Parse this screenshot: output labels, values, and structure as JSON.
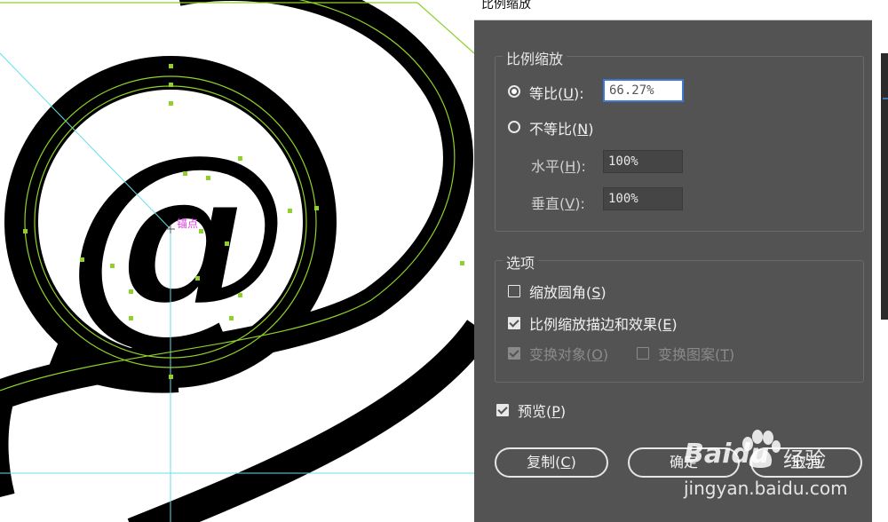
{
  "canvas": {
    "anchor_label": "锚点"
  },
  "dialog": {
    "title": "比例缩放",
    "scale_group": {
      "title": "比例缩放",
      "uniform": {
        "label": "等比",
        "key": "U",
        "value": "66.27%",
        "selected": true
      },
      "non_uniform": {
        "label": "不等比",
        "key": "N",
        "selected": false
      },
      "horizontal": {
        "label": "水平",
        "key": "H",
        "value": "100%"
      },
      "vertical": {
        "label": "垂直",
        "key": "V",
        "value": "100%"
      }
    },
    "options_group": {
      "title": "选项",
      "scale_corners": {
        "label": "缩放圆角",
        "key": "S",
        "checked": false
      },
      "scale_strokes": {
        "label": "比例缩放描边和效果",
        "key": "E",
        "checked": true
      },
      "transform_objects": {
        "label": "变换对象",
        "key": "O",
        "checked": true,
        "disabled": true
      },
      "transform_patterns": {
        "label": "变换图案",
        "key": "T",
        "checked": false,
        "disabled": true
      }
    },
    "preview": {
      "label": "预览",
      "key": "P",
      "checked": true
    },
    "buttons": {
      "copy": {
        "label": "复制",
        "key": "C"
      },
      "ok": {
        "label": "确定"
      },
      "cancel": {
        "label": "取消"
      }
    }
  },
  "watermark": {
    "brand": "Baidu",
    "brand_cn": "经验",
    "url": "jingyan.baidu.com"
  },
  "colors": {
    "dialog_bg": "#535353",
    "guide_cyan": "#66e0ea",
    "path_green": "#8fd12a",
    "anchor_magenta": "#e040e0"
  }
}
